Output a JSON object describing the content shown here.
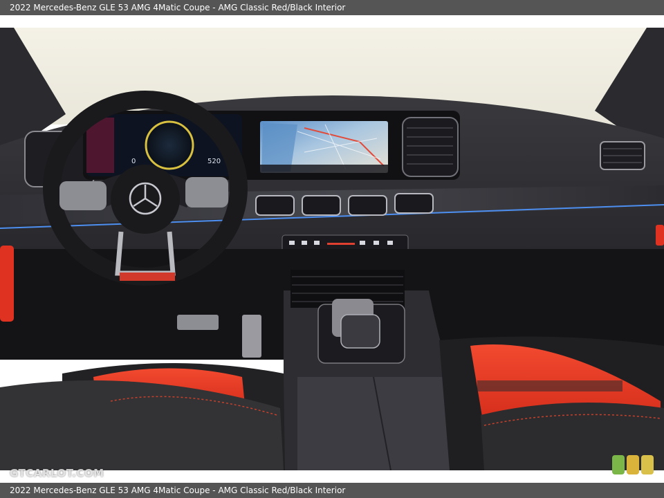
{
  "caption": {
    "top": "2022 Mercedes-Benz GLE 53 AMG 4Matic Coupe - AMG Classic Red/Black Interior",
    "bottom": "2022 Mercedes-Benz GLE 53 AMG 4Matic Coupe - AMG Classic Red/Black Interior"
  },
  "watermark": "GTCARLOT.COM",
  "cluster": {
    "left_readout": "0",
    "right_readout": "520"
  },
  "colors": {
    "seat_red": "#e8321f",
    "dash_dark": "#2a2a2e",
    "badge_green": "#7ab648",
    "badge_yellow": "#d9b33a",
    "badge_gold": "#d8c04a"
  }
}
